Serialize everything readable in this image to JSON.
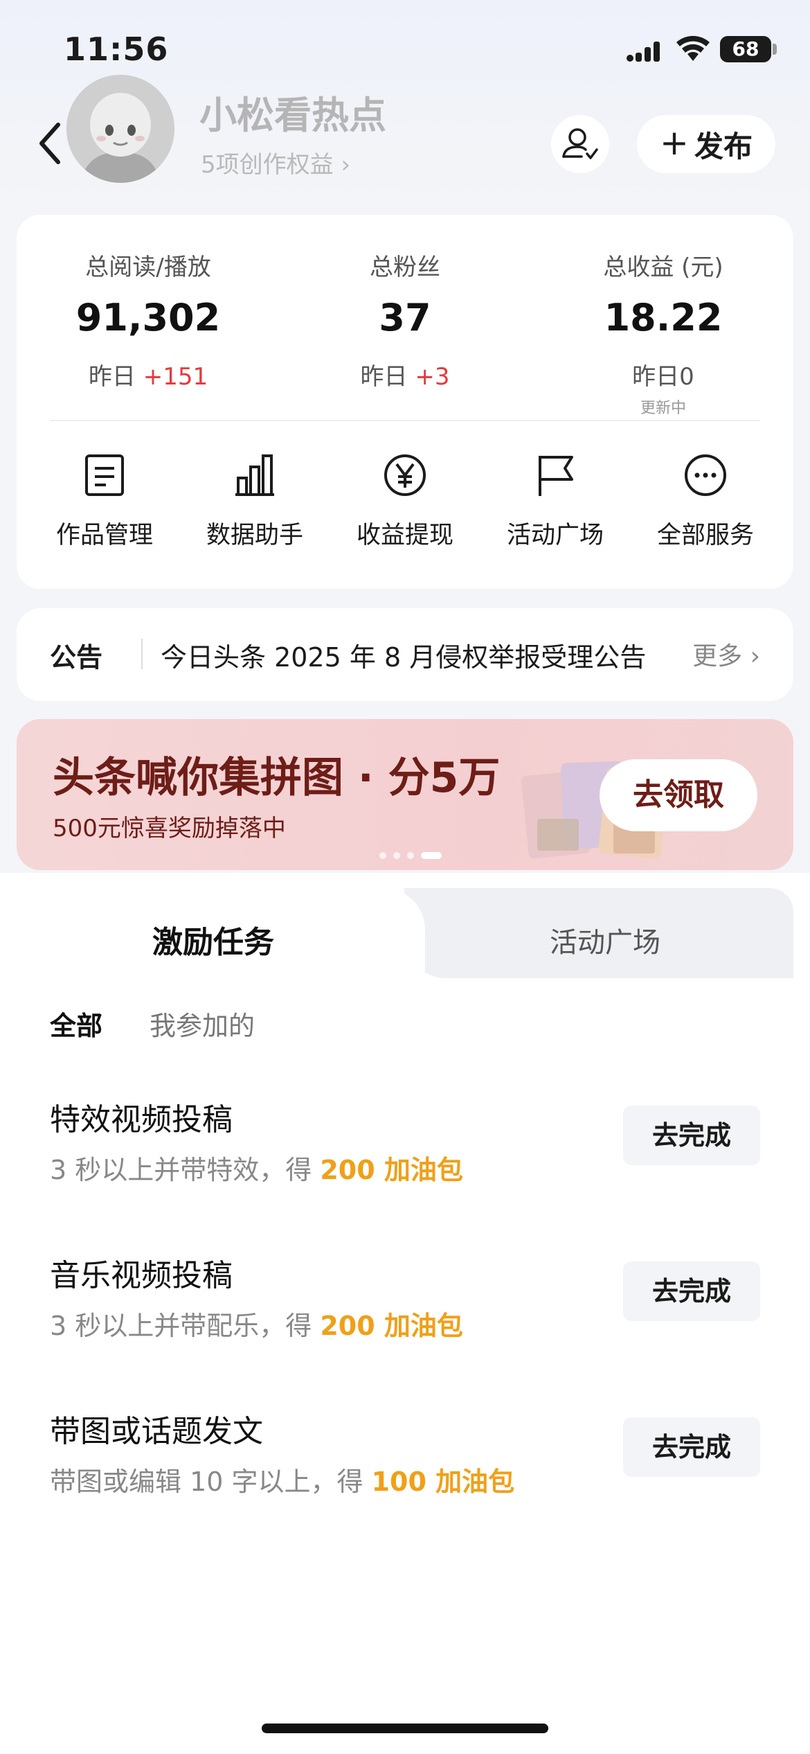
{
  "status_bar": {
    "time": "11:56",
    "battery": "68"
  },
  "header": {
    "nickname": "小松看热点",
    "rights_link": "5项创作权益 ›",
    "publish_label": "发布",
    "publish_plus": "+"
  },
  "stats": [
    {
      "label": "总阅读/播放",
      "value": "91,302",
      "sub_prefix": "昨日 ",
      "delta": "+151",
      "note": ""
    },
    {
      "label": "总粉丝",
      "value": "37",
      "sub_prefix": "昨日 ",
      "delta": "+3",
      "note": ""
    },
    {
      "label": "总收益 (元)",
      "value": "18.22",
      "sub_prefix": "昨日0",
      "delta": "",
      "note": "更新中"
    }
  ],
  "tools": [
    {
      "label": "作品管理",
      "icon": "document-icon"
    },
    {
      "label": "数据助手",
      "icon": "bar-chart-icon"
    },
    {
      "label": "收益提现",
      "icon": "yuan-icon"
    },
    {
      "label": "活动广场",
      "icon": "flag-icon"
    },
    {
      "label": "全部服务",
      "icon": "more-icon"
    }
  ],
  "notice": {
    "tag": "公告",
    "text": "今日头条 2025 年 8 月侵权举报受理公告",
    "more": "更多 ›"
  },
  "banner": {
    "title": "头条喊你集拼图 · 分5万",
    "subtitle": "500元惊喜奖励掉落中",
    "button": "去领取",
    "active_slide": 4,
    "slide_count": 4
  },
  "tasks_section": {
    "tabs": [
      "激励任务",
      "活动广场"
    ],
    "filters": [
      "全部",
      "我参加的"
    ],
    "items": [
      {
        "title": "特效视频投稿",
        "desc_prefix": "3 秒以上并带特效，得 ",
        "reward": "200 加油包",
        "button": "去完成"
      },
      {
        "title": "音乐视频投稿",
        "desc_prefix": "3 秒以上并带配乐，得 ",
        "reward": "200 加油包",
        "button": "去完成"
      },
      {
        "title": "带图或话题发文",
        "desc_prefix": "带图或编辑 10 字以上，得 ",
        "reward": "100 加油包",
        "button": "去完成"
      }
    ]
  },
  "colors": {
    "accent_red": "#e8383b",
    "reward_orange": "#f0a018",
    "banner_text": "#6e1d17"
  }
}
